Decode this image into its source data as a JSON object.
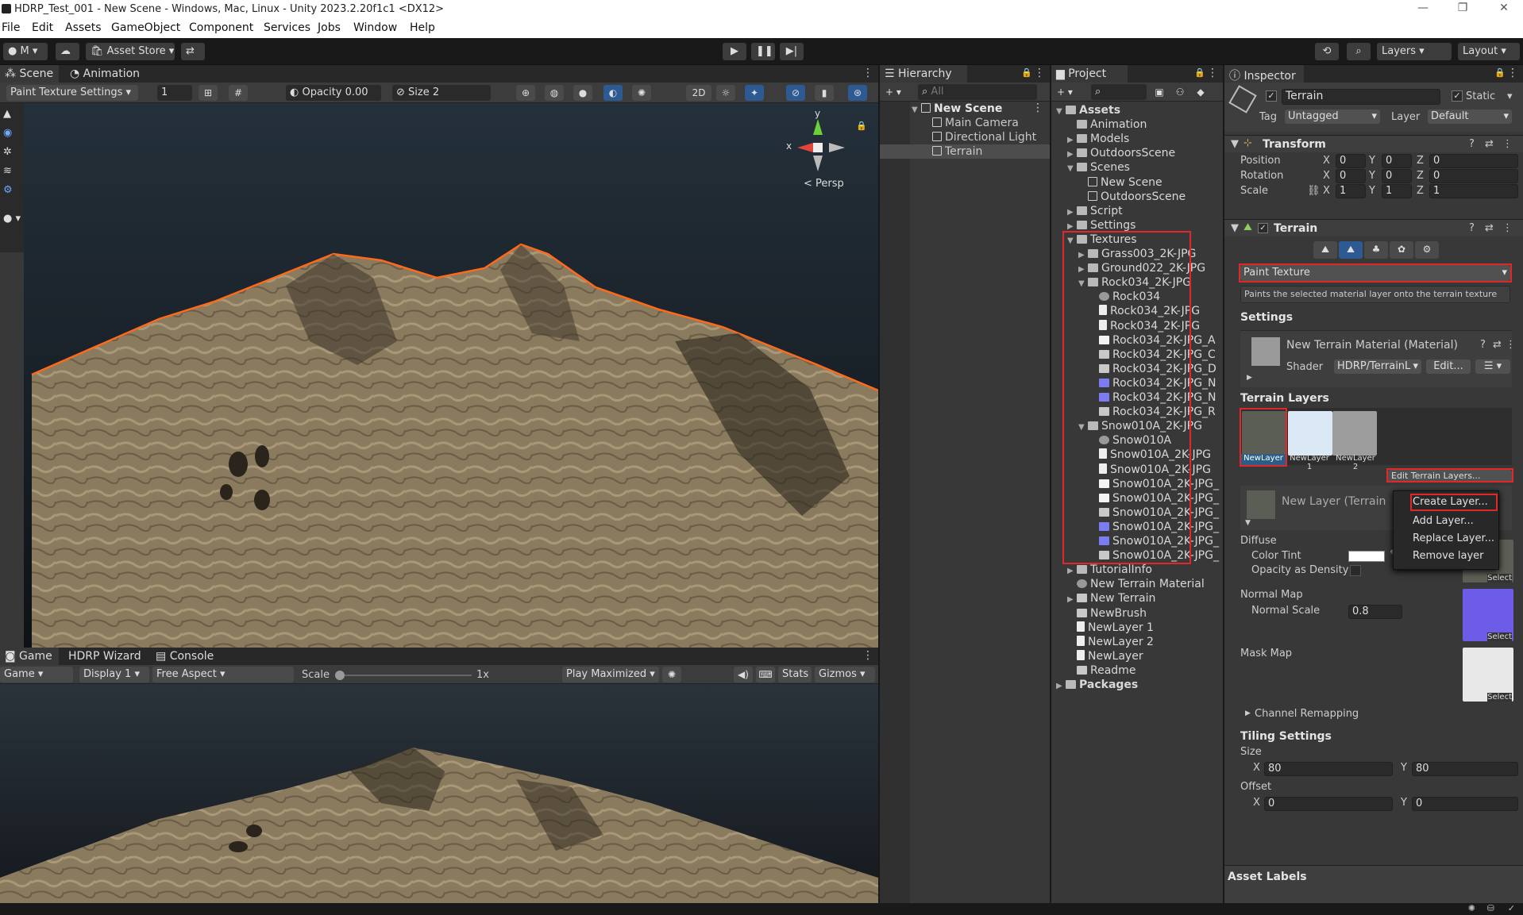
{
  "window": {
    "title": "HDRP_Test_001 - New Scene - Windows, Mac, Linux - Unity 2023.2.20f1c1 <DX12>"
  },
  "menu": [
    "File",
    "Edit",
    "Assets",
    "GameObject",
    "Component",
    "Services",
    "Jobs",
    "Window",
    "Help"
  ],
  "toolbar": {
    "account": "M",
    "asset_store": "Asset Store",
    "layers": "Layers",
    "layout": "Layout"
  },
  "scene": {
    "tabs": [
      "Scene",
      "Animation"
    ],
    "mode": "Paint Texture Settings",
    "brush_index": "1",
    "opacity": "Opacity 0.00",
    "size": "Size 2",
    "btn_2d": "2D",
    "gizmo_y": "y",
    "gizmo_x": "x",
    "persp": "< Persp"
  },
  "game": {
    "tabs": [
      "Game",
      "HDRP Wizard",
      "Console"
    ],
    "view": "Game",
    "display": "Display 1",
    "aspect": "Free Aspect",
    "scale_label": "Scale",
    "scale_value": "1x",
    "play_mode": "Play Maximized",
    "stats": "Stats",
    "gizmos": "Gizmos"
  },
  "hierarchy": {
    "tab": "Hierarchy",
    "search_placeholder": "All",
    "scene": "New Scene",
    "items": [
      "Main Camera",
      "Directional Light",
      "Terrain"
    ]
  },
  "project": {
    "tab": "Project",
    "items": [
      {
        "label": "Assets",
        "depth": 0,
        "icon": "folder",
        "fold": "▼",
        "bold": true
      },
      {
        "label": "Animation",
        "depth": 1,
        "icon": "folder",
        "fold": ""
      },
      {
        "label": "Models",
        "depth": 1,
        "icon": "folder",
        "fold": "▶"
      },
      {
        "label": "OutdoorsScene",
        "depth": 1,
        "icon": "folder",
        "fold": "▶"
      },
      {
        "label": "Scenes",
        "depth": 1,
        "icon": "folder",
        "fold": "▼"
      },
      {
        "label": "New Scene",
        "depth": 2,
        "icon": "cube",
        "fold": ""
      },
      {
        "label": "OutdoorsScene",
        "depth": 2,
        "icon": "cube",
        "fold": ""
      },
      {
        "label": "Script",
        "depth": 1,
        "icon": "folder",
        "fold": "▶"
      },
      {
        "label": "Settings",
        "depth": 1,
        "icon": "folder",
        "fold": "▶"
      },
      {
        "label": "Textures",
        "depth": 1,
        "icon": "folder",
        "fold": "▼"
      },
      {
        "label": "Grass003_2K-JPG",
        "depth": 2,
        "icon": "folder",
        "fold": "▶"
      },
      {
        "label": "Ground022_2K-JPG",
        "depth": 2,
        "icon": "folder",
        "fold": "▶"
      },
      {
        "label": "Rock034_2K-JPG",
        "depth": 2,
        "icon": "folder",
        "fold": "▼"
      },
      {
        "label": "Rock034",
        "depth": 3,
        "icon": "sphere",
        "fold": ""
      },
      {
        "label": "Rock034_2K-JPG",
        "depth": 3,
        "icon": "doc",
        "fold": ""
      },
      {
        "label": "Rock034_2K-JPG",
        "depth": 3,
        "icon": "doc",
        "fold": ""
      },
      {
        "label": "Rock034_2K-JPG_A",
        "depth": 3,
        "icon": "white",
        "fold": ""
      },
      {
        "label": "Rock034_2K-JPG_C",
        "depth": 3,
        "icon": "tex",
        "fold": ""
      },
      {
        "label": "Rock034_2K-JPG_D",
        "depth": 3,
        "icon": "tex",
        "fold": ""
      },
      {
        "label": "Rock034_2K-JPG_N",
        "depth": 3,
        "icon": "blue",
        "fold": ""
      },
      {
        "label": "Rock034_2K-JPG_N",
        "depth": 3,
        "icon": "blue",
        "fold": ""
      },
      {
        "label": "Rock034_2K-JPG_R",
        "depth": 3,
        "icon": "tex",
        "fold": ""
      },
      {
        "label": "Snow010A_2K-JPG",
        "depth": 2,
        "icon": "folder",
        "fold": "▼"
      },
      {
        "label": "Snow010A",
        "depth": 3,
        "icon": "sphere",
        "fold": ""
      },
      {
        "label": "Snow010A_2K-JPG",
        "depth": 3,
        "icon": "doc",
        "fold": ""
      },
      {
        "label": "Snow010A_2K-JPG",
        "depth": 3,
        "icon": "doc",
        "fold": ""
      },
      {
        "label": "Snow010A_2K-JPG_",
        "depth": 3,
        "icon": "white",
        "fold": ""
      },
      {
        "label": "Snow010A_2K-JPG_",
        "depth": 3,
        "icon": "white",
        "fold": ""
      },
      {
        "label": "Snow010A_2K-JPG_",
        "depth": 3,
        "icon": "tex",
        "fold": ""
      },
      {
        "label": "Snow010A_2K-JPG_",
        "depth": 3,
        "icon": "blue",
        "fold": ""
      },
      {
        "label": "Snow010A_2K-JPG_",
        "depth": 3,
        "icon": "blue",
        "fold": ""
      },
      {
        "label": "Snow010A_2K-JPG_",
        "depth": 3,
        "icon": "tex",
        "fold": ""
      },
      {
        "label": "TutorialInfo",
        "depth": 1,
        "icon": "folder",
        "fold": "▶"
      },
      {
        "label": "New Terrain Material",
        "depth": 1,
        "icon": "sphere",
        "fold": ""
      },
      {
        "label": "New Terrain",
        "depth": 1,
        "icon": "tex",
        "fold": "▶"
      },
      {
        "label": "NewBrush",
        "depth": 1,
        "icon": "tex",
        "fold": ""
      },
      {
        "label": "NewLayer 1",
        "depth": 1,
        "icon": "doc",
        "fold": ""
      },
      {
        "label": "NewLayer 2",
        "depth": 1,
        "icon": "doc",
        "fold": ""
      },
      {
        "label": "NewLayer",
        "depth": 1,
        "icon": "doc",
        "fold": ""
      },
      {
        "label": "Readme",
        "depth": 1,
        "icon": "tex",
        "fold": ""
      },
      {
        "label": "Packages",
        "depth": 0,
        "icon": "folder",
        "fold": "▶",
        "bold": true
      }
    ]
  },
  "inspector": {
    "tab": "Inspector",
    "object_name": "Terrain",
    "static_label": "Static",
    "tag_label": "Tag",
    "tag_value": "Untagged",
    "layer_label": "Layer",
    "layer_value": "Default",
    "transform": {
      "title": "Transform",
      "rows": [
        {
          "label": "Position",
          "x": "0",
          "y": "0",
          "z": "0"
        },
        {
          "label": "Rotation",
          "x": "0",
          "y": "0",
          "z": "0"
        },
        {
          "label": "Scale",
          "x": "1",
          "y": "1",
          "z": "1"
        }
      ],
      "axis_x": "X",
      "axis_y": "Y",
      "axis_z": "Z"
    },
    "terrain": {
      "title": "Terrain",
      "tool": "Paint Texture",
      "description": "Paints the selected material layer onto the terrain texture",
      "settings_header": "Settings",
      "material_name": "New Terrain Material (Material)",
      "shader_label": "Shader",
      "shader_value": "HDRP/TerrainL",
      "edit_button": "Edit...",
      "layers_header": "Terrain Layers",
      "layers": [
        "NewLayer",
        "NewLayer 1",
        "NewLayer 2"
      ],
      "edit_layers_button": "Edit Terrain Layers...",
      "layer_detail_name": "New Layer (Terrain",
      "diffuse_header": "Diffuse",
      "color_tint": "Color Tint",
      "opacity_density": "Opacity as Density",
      "select": "Select",
      "normal_map": "Normal Map",
      "normal_scale_label": "Normal Scale",
      "normal_scale": "0.8",
      "mask_map": "Mask Map",
      "channel_remapping": "Channel Remapping",
      "tiling_header": "Tiling Settings",
      "size_label": "Size",
      "size_x": "80",
      "size_y": "80",
      "offset_label": "Offset",
      "offset_x": "0",
      "offset_y": "0",
      "axis_x": "X",
      "axis_y": "Y"
    },
    "asset_labels": "Asset Labels"
  },
  "context_menu": [
    "Create Layer...",
    "Add Layer...",
    "Replace Layer...",
    "Remove layer"
  ],
  "colors": {
    "selection": "#2c5d87",
    "highlight_box": "#e02828",
    "accent": "#2d5a93"
  }
}
